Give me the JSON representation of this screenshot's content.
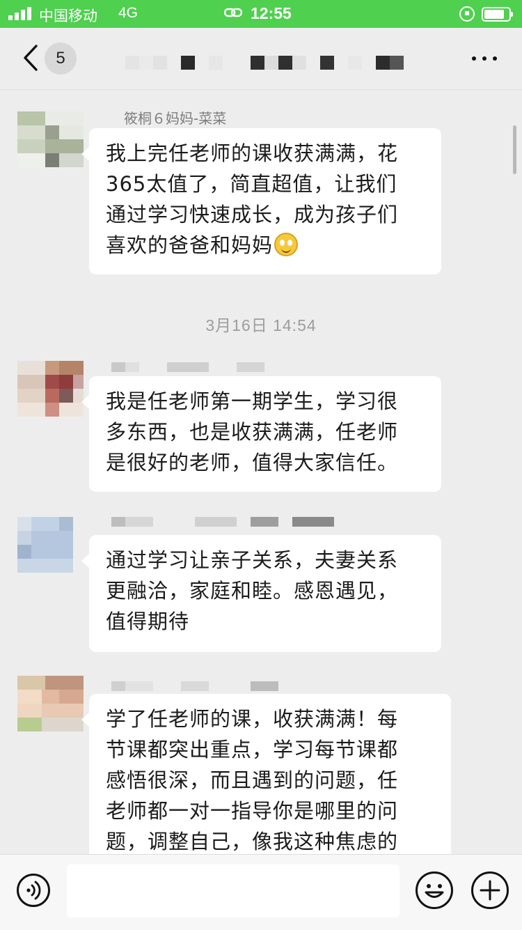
{
  "status_bar": {
    "carrier": "中国移动",
    "network": "4G",
    "time": "12:55"
  },
  "nav": {
    "unread_count": "5"
  },
  "messages": [
    {
      "sender": "筱桐６妈妈-菜菜",
      "text_lines": [
        "我上完任老师的课收获满满，花",
        "365太值了，简直超值，让我们",
        "通过学习快速成长，成为孩子们",
        "喜欢的爸爸和妈妈"
      ],
      "emoji": "smile-emoji"
    },
    {
      "sender": "",
      "text_lines": [
        "我是任老师第一期学生，学习很",
        "多东西，也是收获满满，任老师",
        "是很好的老师，值得大家信任。"
      ]
    },
    {
      "sender": "",
      "text_lines": [
        "通过学习让亲子关系，夫妻关系",
        "更融洽，家庭和睦。感恩遇见，",
        "值得期待"
      ]
    },
    {
      "sender": "",
      "text_lines": [
        "学了任老师的课，收获满满！每",
        "节课都突出重点，学习每节课都",
        "感悟很深，而且遇到的问题，任",
        "老师都一对一指导你是哪里的问",
        "题，调整自己，像我这种焦虑的"
      ]
    }
  ],
  "timestamp": "3月16日 14:54",
  "colors": {
    "status_bar": "#4fd04f",
    "chat_background": "#ededed",
    "bubble": "#ffffff",
    "timestamp_text": "#9d9d9d"
  },
  "icons": [
    "signal-icon",
    "link-icon",
    "rotation-lock-icon",
    "battery-icon",
    "back-chevron-icon",
    "more-dots-icon",
    "voice-icon",
    "emoji-icon",
    "plus-icon"
  ]
}
